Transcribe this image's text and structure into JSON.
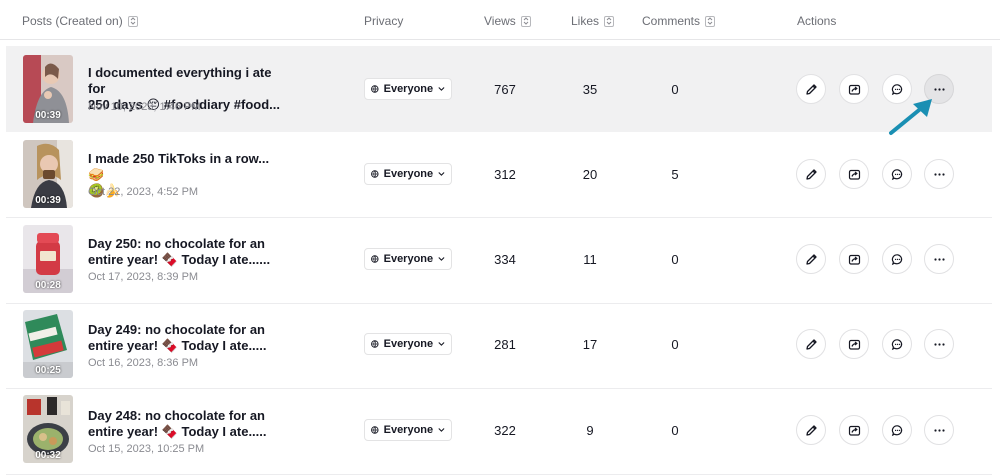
{
  "header": {
    "posts": "Posts (Created on)",
    "privacy": "Privacy",
    "views": "Views",
    "likes": "Likes",
    "comments": "Comments",
    "actions": "Actions"
  },
  "posts": [
    {
      "title_line1": "I documented everything i ate for",
      "title_line2": "250 days 😔 #fooddiary #food...",
      "date": "Nov 10, 2023, 1:46 PM",
      "duration": "00:39",
      "privacy": "Everyone",
      "views": "767",
      "likes": "35",
      "comments": "0"
    },
    {
      "title_line1": "I made 250 TikToks in a row... 🥪",
      "title_line2": "🥝🍌",
      "date": "Oct 22, 2023, 4:52 PM",
      "duration": "00:39",
      "privacy": "Everyone",
      "views": "312",
      "likes": "20",
      "comments": "5"
    },
    {
      "title_line1": "Day 250: no chocolate for an",
      "title_line2": "entire year! 🍫 Today I ate......",
      "date": "Oct 17, 2023, 8:39 PM",
      "duration": "00:28",
      "privacy": "Everyone",
      "views": "334",
      "likes": "11",
      "comments": "0"
    },
    {
      "title_line1": "Day 249: no chocolate for an",
      "title_line2": "entire year! 🍫 Today I ate.....",
      "date": "Oct 16, 2023, 8:36 PM",
      "duration": "00:25",
      "privacy": "Everyone",
      "views": "281",
      "likes": "17",
      "comments": "0"
    },
    {
      "title_line1": "Day 248: no chocolate for an",
      "title_line2": "entire year! 🍫 Today I ate.....",
      "date": "Oct 15, 2023, 10:25 PM",
      "duration": "00:32",
      "privacy": "Everyone",
      "views": "322",
      "likes": "9",
      "comments": "0"
    }
  ],
  "colors": {
    "annotation_arrow": "#1a8fb3",
    "highlight_row": "#f1f1f2"
  },
  "icons": {
    "privacy": "globe-icon",
    "dropdown": "chevron-down-icon",
    "edit": "pencil-icon",
    "share": "share-icon",
    "comments": "comment-icon",
    "more": "more-icon"
  }
}
